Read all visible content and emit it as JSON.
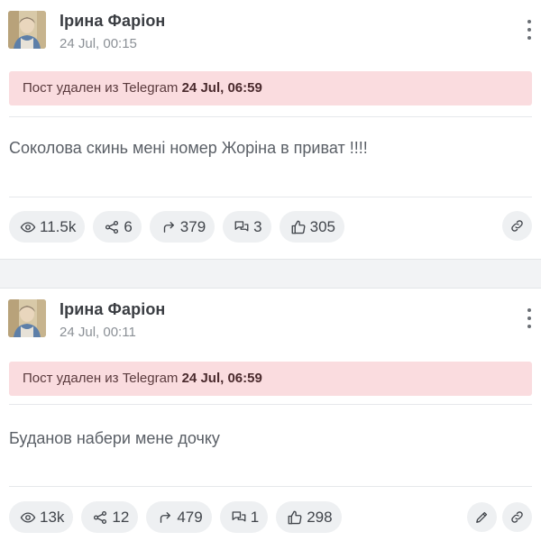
{
  "colors": {
    "deleted_bg": "#fadcdf",
    "pill_bg": "#eef0f2",
    "separator_bg": "#f2f3f5",
    "author_text": "#3a3d42",
    "date_text": "#8b9096"
  },
  "posts": [
    {
      "author": "Ірина Фаріон",
      "date": "24 Jul, 00:15",
      "deleted_prefix": "Пост удален из Telegram",
      "deleted_time": "24 Jul, 06:59",
      "text": "Соколова скинь мені номер Жоріна в приват !!!!",
      "stats": {
        "views": "11.5k",
        "shares": "6",
        "forwards": "379",
        "comments": "3",
        "likes": "305"
      },
      "icons": [
        "avatar",
        "more-vertical-icon",
        "eye-icon",
        "share-icon",
        "forward-icon",
        "comments-icon",
        "thumbs-up-icon",
        "link-icon"
      ]
    },
    {
      "author": "Ірина Фаріон",
      "date": "24 Jul, 00:11",
      "deleted_prefix": "Пост удален из Telegram",
      "deleted_time": "24 Jul, 06:59",
      "text": "Буданов набери мене дочку",
      "stats": {
        "views": "13k",
        "shares": "12",
        "forwards": "479",
        "comments": "1",
        "likes": "298"
      },
      "icons": [
        "avatar",
        "more-vertical-icon",
        "eye-icon",
        "share-icon",
        "forward-icon",
        "comments-icon",
        "thumbs-up-icon",
        "pencil-icon",
        "link-icon"
      ]
    }
  ]
}
